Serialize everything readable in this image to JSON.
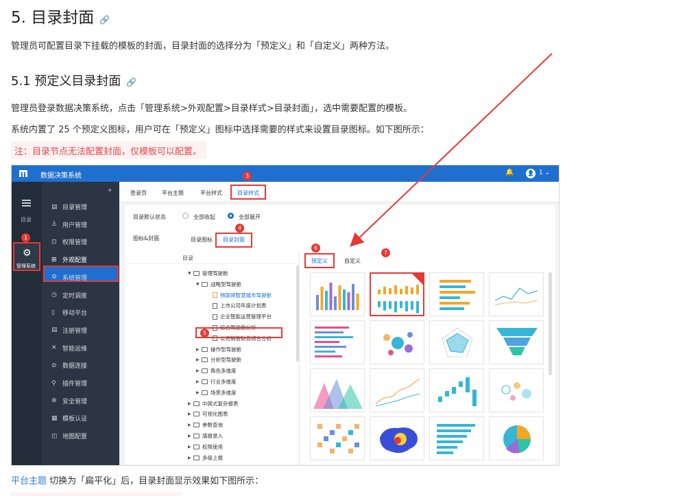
{
  "doc": {
    "h1": "5. 目录封面",
    "intro": "管理员可配置目录下挂载的模板的封面，目录封面的选择分为「预定义」和「自定义」两种方法。",
    "h2": "5.1 预定义目录封面",
    "p1": "管理员登录数据决策系统，点击「管理系统>外观配置>目录样式>目录封面」，选中需要配置的模板。",
    "p2": "系统内置了 25 个预定义图标，用户可在「预定义」图标中选择需要的样式来设置目录图标。如下图所示：",
    "note": "注：目录节点无法配置封面，仅模板可以配置。",
    "bottom_link": "平台主题",
    "bottom_text": " 切换为「扁平化」后，目录封面显示效果如下图所示：",
    "anchor_glyph": "🔗"
  },
  "app": {
    "title": "数据决策系统",
    "user": "1 ⌄",
    "bell": "🔔",
    "avatar": "👤",
    "rail_label": "目录",
    "rail_active": "管理系统",
    "sidebar": [
      {
        "icon": "▤",
        "label": "目录管理"
      },
      {
        "icon": "♙",
        "label": "用户管理"
      },
      {
        "icon": "⊡",
        "label": "权限管理"
      },
      {
        "icon": "⊞",
        "label": "外观配置"
      },
      {
        "icon": "⚙",
        "label": "系统管理"
      },
      {
        "icon": "◷",
        "label": "定时调度"
      },
      {
        "icon": "▯",
        "label": "移动平台"
      },
      {
        "icon": "▤",
        "label": "注册管理"
      },
      {
        "icon": "✕",
        "label": "智能运维"
      },
      {
        "icon": "⊘",
        "label": "数据连接"
      },
      {
        "icon": "⚲",
        "label": "插件管理"
      },
      {
        "icon": "⊕",
        "label": "安全管理"
      },
      {
        "icon": "▦",
        "label": "模板认证"
      },
      {
        "icon": "◰",
        "label": "地图配置"
      }
    ],
    "tabs": [
      "登录页",
      "平台主题",
      "平台样式",
      "目录样式"
    ],
    "selected_tab": 3,
    "default_state_label": "目录默认状态",
    "radio_collapse": "全部收起",
    "radio_expand": "全部展开",
    "icon_cover_label": "图标&封面",
    "subtabs": [
      "目录图标",
      "目录封面"
    ],
    "tree_header": "目录",
    "tree": [
      {
        "level": 0,
        "caret": "▼",
        "type": "folder",
        "label": "管理驾驶舱"
      },
      {
        "level": 1,
        "caret": "▼",
        "type": "folder",
        "label": "战略型驾驶舱"
      },
      {
        "level": 2,
        "caret": "",
        "type": "file",
        "label": "物联网智慧城市驾驶舱",
        "selected": true
      },
      {
        "level": 2,
        "caret": "",
        "type": "file",
        "label": "上市公司年度计划表"
      },
      {
        "level": 2,
        "caret": "",
        "type": "file",
        "label": "企业智能运营管理平台"
      },
      {
        "level": 2,
        "caret": "",
        "type": "file",
        "label": "综合驾驶舱分析"
      },
      {
        "level": 2,
        "caret": "",
        "type": "file",
        "label": "公司销售财务综合分析"
      },
      {
        "level": 1,
        "caret": "▶",
        "type": "folder",
        "label": "操作型驾驶舱"
      },
      {
        "level": 1,
        "caret": "▶",
        "type": "folder",
        "label": "分析型驾驶舱"
      },
      {
        "level": 1,
        "caret": "▶",
        "type": "folder",
        "label": "角色多维度"
      },
      {
        "level": 1,
        "caret": "▶",
        "type": "folder",
        "label": "行业多维度"
      },
      {
        "level": 1,
        "caret": "▶",
        "type": "folder",
        "label": "场景多维度"
      },
      {
        "level": 0,
        "caret": "▶",
        "type": "folder",
        "label": "中国式复杂报表"
      },
      {
        "level": 0,
        "caret": "▶",
        "type": "folder",
        "label": "可视化图表"
      },
      {
        "level": 0,
        "caret": "▶",
        "type": "folder",
        "label": "参数查询"
      },
      {
        "level": 0,
        "caret": "▶",
        "type": "folder",
        "label": "填报录入"
      },
      {
        "level": 0,
        "caret": "▶",
        "type": "folder",
        "label": "权限使用"
      },
      {
        "level": 0,
        "caret": "▶",
        "type": "folder",
        "label": "多级上报"
      }
    ],
    "cover_tabs": [
      "预定义",
      "自定义"
    ],
    "badges": [
      "1",
      "2",
      "3",
      "4",
      "5",
      "6",
      "7"
    ],
    "thumbnails": [
      "bar-chart-icon",
      "stacked-bar-chart-icon",
      "horizontal-bar-chart-icon",
      "line-chart-icon",
      "horizontal-bars-icon",
      "bubble-map-icon",
      "radar-chart-icon",
      "funnel-chart-icon",
      "area-chart-icon",
      "rising-line-chart-icon",
      "waterfall-chart-icon",
      "bubble-chart-icon",
      "heatmap-grid-icon",
      "china-heatmap-icon",
      "ranked-bars-icon",
      "pie-chart-icon"
    ],
    "colors": {
      "primary": "#1f6fcf",
      "sidebar": "#2b3544",
      "rail": "#232c39",
      "highlight": "#e53935",
      "orange": "#f5a623",
      "teal": "#35b6d6"
    }
  }
}
